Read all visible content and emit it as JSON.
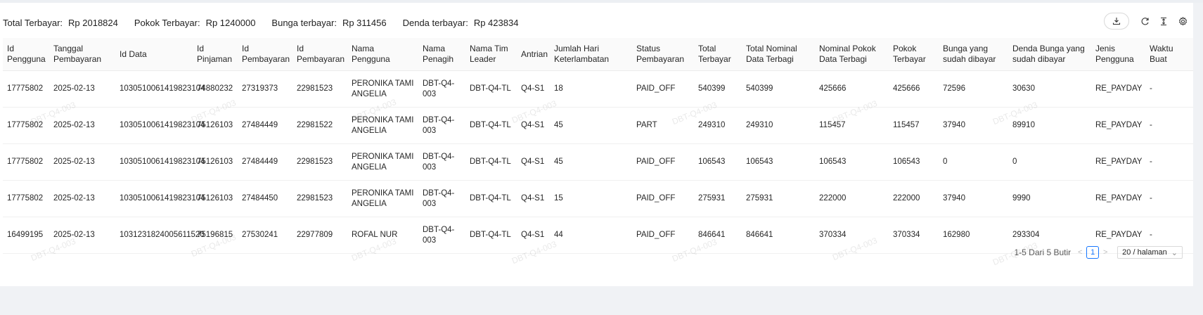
{
  "summary": {
    "total_label": "Total Terbayar:",
    "total_value": "Rp 2018824",
    "principal_label": "Pokok Terbayar:",
    "principal_value": "Rp 1240000",
    "interest_label": "Bunga terbayar:",
    "interest_value": "Rp 311456",
    "penalty_label": "Denda terbayar:",
    "penalty_value": "Rp 423834"
  },
  "toolbar": {
    "icons": [
      "download-icon",
      "reload-icon",
      "column-height-icon",
      "settings-icon"
    ]
  },
  "table": {
    "columns": [
      "Id Pengguna",
      "Tanggal Pembayaran",
      "Id Data",
      "Id Pinjaman",
      "Id Pembayaran",
      "Id Pembayaran",
      "Nama Pengguna",
      "Nama Penagih",
      "Nama Tim Leader",
      "Antrian",
      "Jumlah Hari Keterlambatan",
      "Status Pembayaran",
      "Total Terbayar",
      "Total Nominal Data Terbagi",
      "Nominal Pokok Data Terbagi",
      "Pokok Terbayar",
      "Bunga yang sudah dibayar",
      "Denda Bunga yang sudah dibayar",
      "Jenis Pengguna",
      "Waktu Buat"
    ],
    "rows": [
      [
        "17775802",
        "2025-02-13",
        "1030510061419823104",
        "74880232",
        "27319373",
        "22981523",
        "PERONIKA TAMI ANGELIA",
        "DBT-Q4-003",
        "DBT-Q4-TL",
        "Q4-S1",
        "18",
        "PAID_OFF",
        "540399",
        "540399",
        "425666",
        "425666",
        "72596",
        "30630",
        "RE_PAYDAY",
        "-"
      ],
      [
        "17775802",
        "2025-02-13",
        "1030510061419823104",
        "75126103",
        "27484449",
        "22981522",
        "PERONIKA TAMI ANGELIA",
        "DBT-Q4-003",
        "DBT-Q4-TL",
        "Q4-S1",
        "45",
        "PART",
        "249310",
        "249310",
        "115457",
        "115457",
        "37940",
        "89910",
        "RE_PAYDAY",
        "-"
      ],
      [
        "17775802",
        "2025-02-13",
        "1030510061419823104",
        "75126103",
        "27484449",
        "22981523",
        "PERONIKA TAMI ANGELIA",
        "DBT-Q4-003",
        "DBT-Q4-TL",
        "Q4-S1",
        "45",
        "PAID_OFF",
        "106543",
        "106543",
        "106543",
        "106543",
        "0",
        "0",
        "RE_PAYDAY",
        "-"
      ],
      [
        "17775802",
        "2025-02-13",
        "1030510061419823104",
        "75126103",
        "27484450",
        "22981523",
        "PERONIKA TAMI ANGELIA",
        "DBT-Q4-003",
        "DBT-Q4-TL",
        "Q4-S1",
        "15",
        "PAID_OFF",
        "275931",
        "275931",
        "222000",
        "222000",
        "37940",
        "9990",
        "RE_PAYDAY",
        "-"
      ],
      [
        "16499195",
        "2025-02-13",
        "1031231824005611520",
        "75196815",
        "27530241",
        "22977809",
        "ROFAL NUR",
        "DBT-Q4-003",
        "DBT-Q4-TL",
        "Q4-S1",
        "44",
        "PAID_OFF",
        "846641",
        "846641",
        "370334",
        "370334",
        "162980",
        "293304",
        "RE_PAYDAY",
        "-"
      ]
    ]
  },
  "pagination": {
    "total_text": "1-5 Dari 5 Butir",
    "prev": "<",
    "current_page": "1",
    "next": ">",
    "page_size": "20 / halaman"
  },
  "watermark": {
    "text": "DBT-Q4-003"
  }
}
